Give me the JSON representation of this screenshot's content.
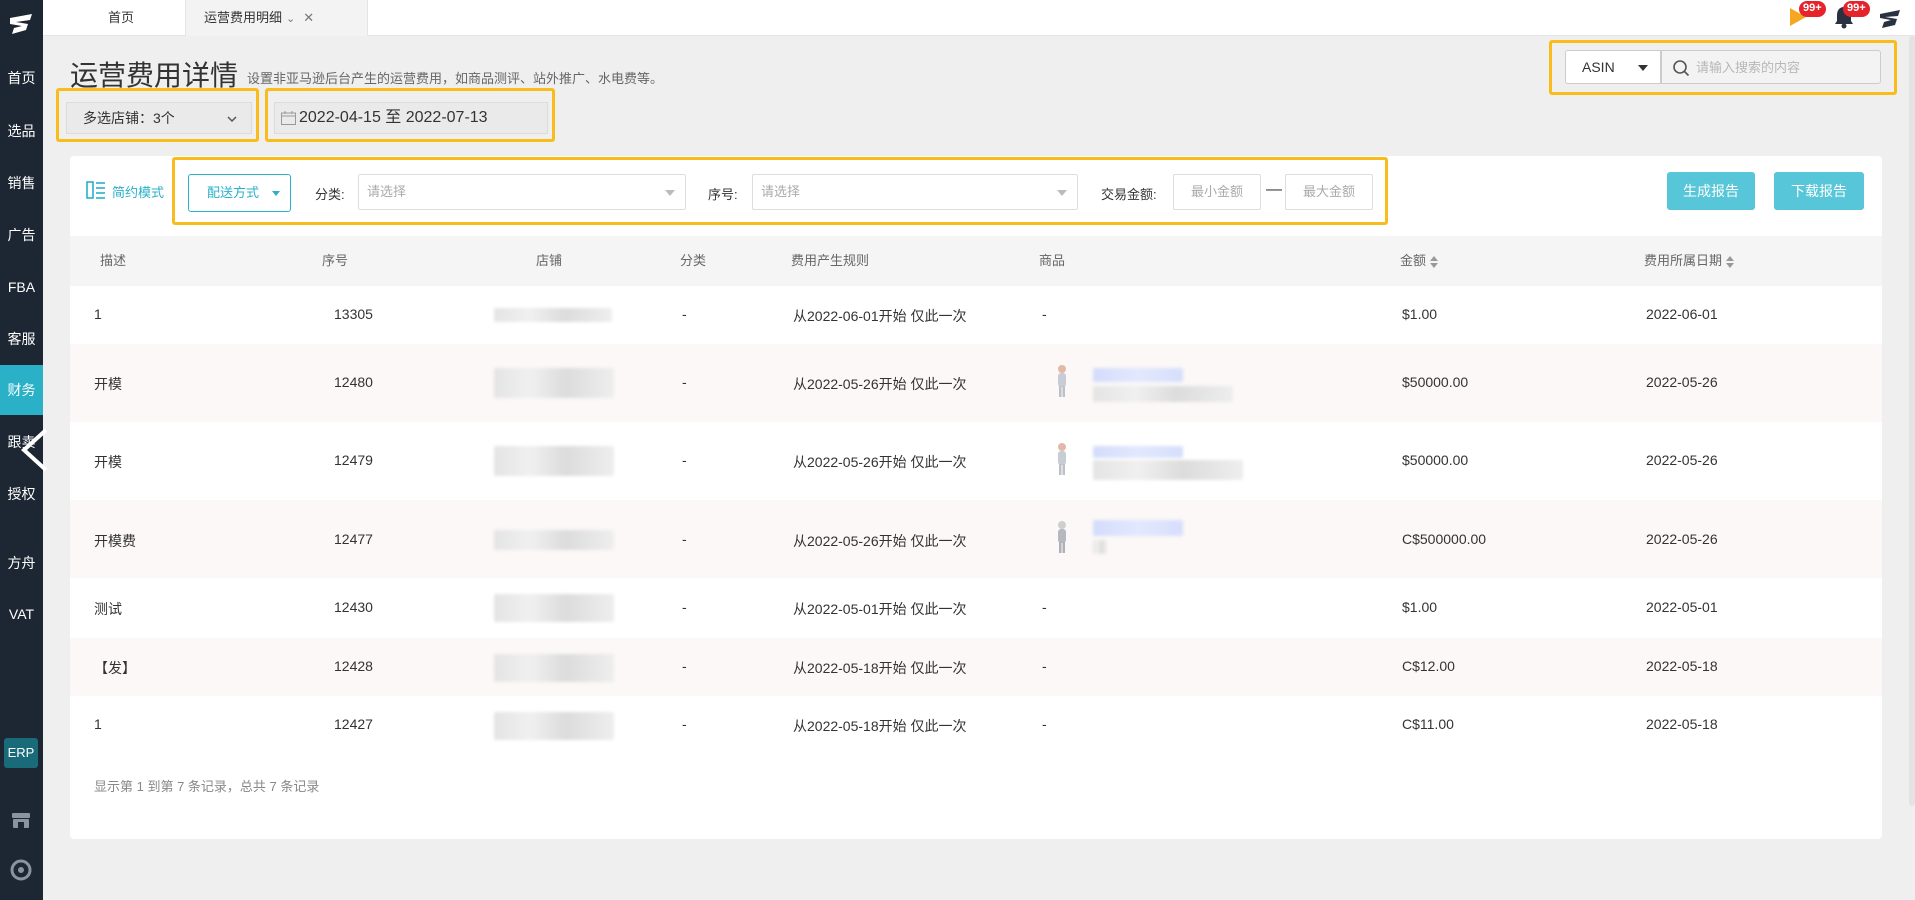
{
  "sidebar": {
    "items": [
      {
        "label": "首页"
      },
      {
        "label": "选品"
      },
      {
        "label": "销售"
      },
      {
        "label": "广告"
      },
      {
        "label": "FBA"
      },
      {
        "label": "客服"
      },
      {
        "label": "财务"
      },
      {
        "label": "跟卖"
      },
      {
        "label": "授权"
      },
      {
        "label": "方舟"
      },
      {
        "label": "VAT"
      }
    ],
    "active_index": 6,
    "erp_label": "ERP"
  },
  "tabs": {
    "home": "首页",
    "current": "运营费用明细"
  },
  "topbar": {
    "badge_1": "99+",
    "badge_2": "99+"
  },
  "header": {
    "title": "运营费用详情",
    "description": "设置非亚马逊后台产生的运营费用，如商品测评、站外推广、水电费等。",
    "shop_select": "多选店铺：3个",
    "date_range": "2022-04-15 至 2022-07-13"
  },
  "search": {
    "type": "ASIN",
    "placeholder": "请输入搜索的内容"
  },
  "filters": {
    "mode_label": "简约模式",
    "ship_label": "配送方式",
    "category_label": "分类:",
    "category_placeholder": "请选择",
    "seq_label": "序号:",
    "seq_placeholder": "请选择",
    "amount_label": "交易金额:",
    "min_placeholder": "最小金额",
    "max_placeholder": "最大金额",
    "dash": "—"
  },
  "actions": {
    "generate": "生成报告",
    "download": "下载报告"
  },
  "table": {
    "columns": [
      "描述",
      "序号",
      "店铺",
      "分类",
      "费用产生规则",
      "商品",
      "金额",
      "费用所属日期"
    ],
    "rows": [
      {
        "desc": "1",
        "seq": "13305",
        "category": "-",
        "rule": "从2022-06-01开始 仅此一次",
        "product": "-",
        "amount": "$1.00",
        "date": "2022-06-01"
      },
      {
        "desc": "开模",
        "seq": "12480",
        "category": "-",
        "rule": "从2022-05-26开始 仅此一次",
        "product": "",
        "amount": "$50000.00",
        "date": "2022-05-26"
      },
      {
        "desc": "开模",
        "seq": "12479",
        "category": "-",
        "rule": "从2022-05-26开始 仅此一次",
        "product": "",
        "amount": "$50000.00",
        "date": "2022-05-26"
      },
      {
        "desc": "开模费",
        "seq": "12477",
        "category": "-",
        "rule": "从2022-05-26开始 仅此一次",
        "product": "",
        "amount": "C$500000.00",
        "date": "2022-05-26"
      },
      {
        "desc": "测试",
        "seq": "12430",
        "category": "-",
        "rule": "从2022-05-01开始 仅此一次",
        "product": "-",
        "amount": "$1.00",
        "date": "2022-05-01"
      },
      {
        "desc": "【发】",
        "seq": "12428",
        "category": "-",
        "rule": "从2022-05-18开始 仅此一次",
        "product": "-",
        "amount": "C$12.00",
        "date": "2022-05-18"
      },
      {
        "desc": "1",
        "seq": "12427",
        "category": "-",
        "rule": "从2022-05-18开始 仅此一次",
        "product": "-",
        "amount": "C$11.00",
        "date": "2022-05-18"
      }
    ]
  },
  "pagination": {
    "summary": "显示第 1 到第 7 条记录，总共 7 条记录"
  },
  "colors": {
    "sidebar_bg": "#1d2633",
    "accent": "#2ab1c8",
    "highlight": "#f8bd1d",
    "button": "#56c6d8",
    "badge": "#e6232b"
  }
}
